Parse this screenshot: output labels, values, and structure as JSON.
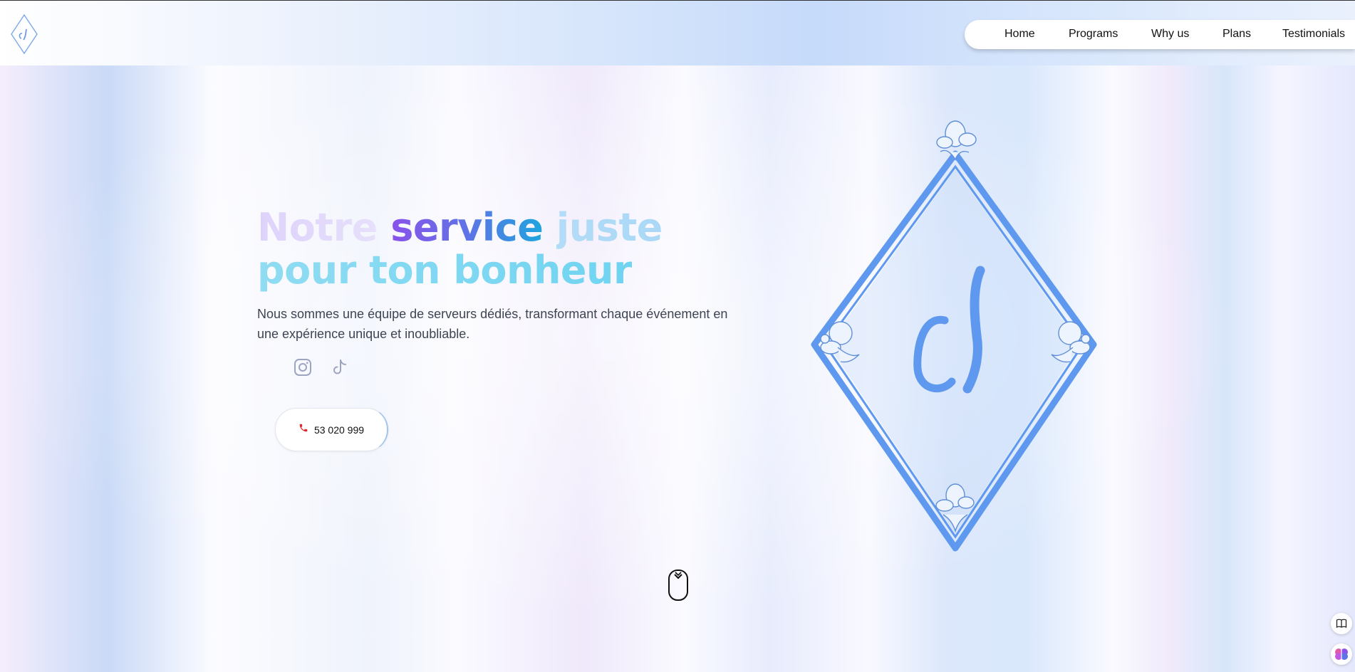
{
  "header": {
    "logo_icon": "diamond-monogram-logo",
    "nav": [
      {
        "label": "Home"
      },
      {
        "label": "Programs"
      },
      {
        "label": "Why us"
      },
      {
        "label": "Plans"
      },
      {
        "label": "Testimonials"
      }
    ]
  },
  "hero": {
    "title": {
      "word1": "Notre",
      "word2": "service",
      "word3": "juste",
      "line2": "pour ton bonheur"
    },
    "subtitle": "Nous sommes une équipe de serveurs dédiés, transformant chaque événement en une expérience unique et inoubliable.",
    "social": [
      {
        "icon": "instagram-icon"
      },
      {
        "icon": "tiktok-icon"
      }
    ],
    "phone": {
      "icon": "phone-icon",
      "number": "53 020 999",
      "icon_color": "#e0262c"
    }
  },
  "emblem": {
    "icon": "floral-diamond-monogram",
    "color": "#5f99ef"
  },
  "scroll_indicator": {
    "icon": "mouse-scroll-icon"
  },
  "side_widgets": [
    {
      "icon": "book-icon"
    },
    {
      "icon": "brain-icon"
    }
  ],
  "colors": {
    "accent_purple": "#8a52ea",
    "accent_blue": "#1ea5de",
    "emblem_blue": "#5f99ef"
  }
}
